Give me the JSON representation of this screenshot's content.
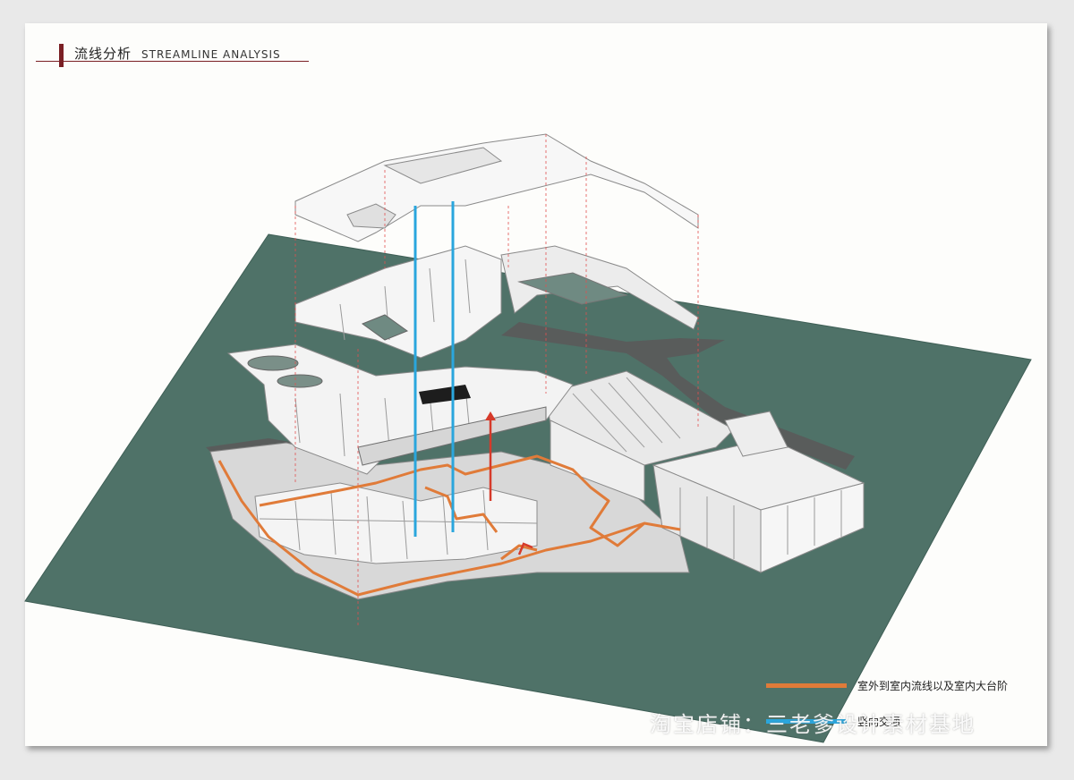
{
  "header": {
    "title_cn": "流线分析",
    "title_en": "STREAMLINE ANALYSIS"
  },
  "legend": [
    {
      "label": "室外到室内流线以及室内大台阶",
      "color": "#e07b39"
    },
    {
      "label": "竖向交通",
      "color": "#2aa6dd"
    }
  ],
  "watermark": "淘宝店铺：三老爹设计素材基地",
  "colors": {
    "site": "#4f7268",
    "building": "#f2f2f2",
    "building_line": "#9a9a9a",
    "road": "#555555",
    "projection_line": "#e05050"
  }
}
